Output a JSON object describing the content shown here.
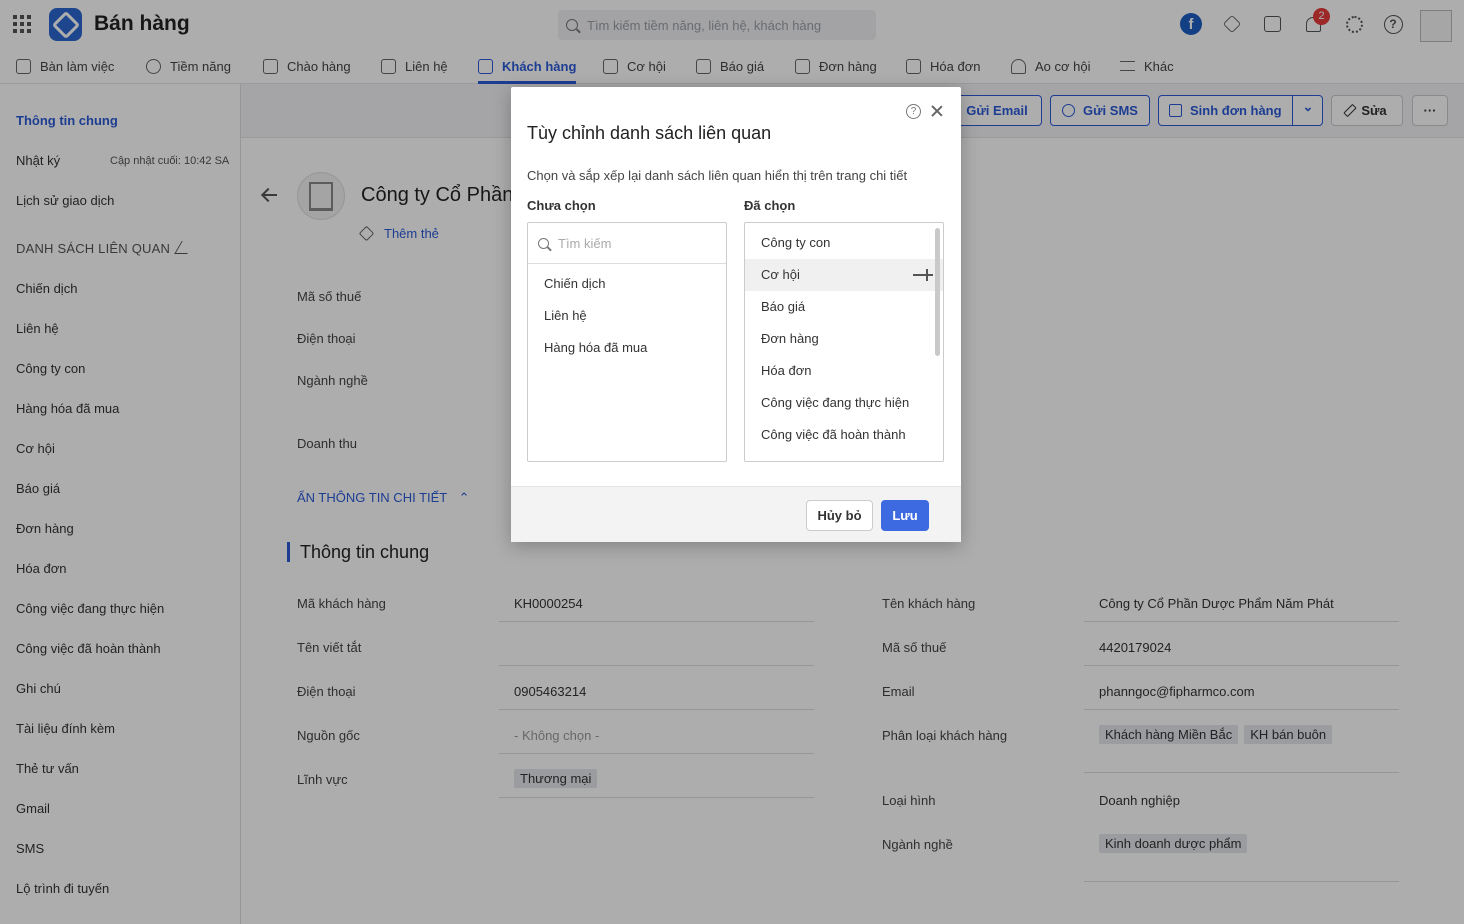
{
  "header": {
    "app_title": "Bán hàng",
    "search_placeholder": "Tìm kiếm tiềm năng, liên hệ, khách hàng",
    "notification_count": "2",
    "facebook_letter": "f"
  },
  "nav": [
    {
      "label": "Bàn làm việc"
    },
    {
      "label": "Tiềm năng"
    },
    {
      "label": "Chào hàng"
    },
    {
      "label": "Liên hệ"
    },
    {
      "label": "Khách hàng"
    },
    {
      "label": "Cơ hội"
    },
    {
      "label": "Báo giá"
    },
    {
      "label": "Đơn hàng"
    },
    {
      "label": "Hóa đơn"
    },
    {
      "label": "Ao cơ hội"
    },
    {
      "label": "Khác"
    }
  ],
  "sidebar": {
    "general_info": "Thông tin chung",
    "diary": "Nhật ký",
    "diary_updated": "Cập nhật cuối: 10:42 SA",
    "history": "Lịch sử giao dịch",
    "related_header": "DANH SÁCH LIÊN QUAN",
    "items": [
      {
        "label": "Chiến dịch"
      },
      {
        "label": "Liên hệ"
      },
      {
        "label": "Công ty con"
      },
      {
        "label": "Hàng hóa đã mua"
      },
      {
        "label": "Cơ hội"
      },
      {
        "label": "Báo giá"
      },
      {
        "label": "Đơn hàng"
      },
      {
        "label": "Hóa đơn"
      },
      {
        "label": "Công việc đang thực hiện"
      },
      {
        "label": "Công việc đã hoàn thành"
      },
      {
        "label": "Ghi chú"
      },
      {
        "label": "Tài liệu đính kèm"
      },
      {
        "label": "Thẻ tư vấn"
      },
      {
        "label": "Gmail"
      },
      {
        "label": "SMS"
      },
      {
        "label": "Lộ trình đi tuyến"
      }
    ],
    "collapse_glyph": "‹"
  },
  "actions": {
    "send_email": "Gửi Email",
    "send_sms": "Gửi SMS",
    "create_order": "Sinh đơn hàng",
    "edit": "Sửa",
    "more": "···",
    "dropdown_glyph": "⌄"
  },
  "record": {
    "company_name": "Công ty Cổ Phần",
    "add_tag": "Thêm thẻ",
    "summary_labels": [
      "Mã số thuế",
      "Điện thoại",
      "Ngành nghề",
      "Doanh thu"
    ],
    "toggle_details": "ẨN THÔNG TIN CHI TIẾT",
    "toggle_glyph": "⌃",
    "section_title": "Thông tin chung",
    "left_fields": [
      {
        "label": "Mã khách hàng",
        "value": "KH0000254"
      },
      {
        "label": "Tên viết tắt",
        "value": ""
      },
      {
        "label": "Điện thoại",
        "value": "0905463214"
      },
      {
        "label": "Nguồn gốc",
        "value": "- Không chọn -"
      },
      {
        "label": "Lĩnh vực",
        "chip": "Thương mại"
      }
    ],
    "right_fields": [
      {
        "label": "Tên khách hàng",
        "value": "Công ty Cổ Phần Dược Phẩm Năm Phát"
      },
      {
        "label": "Mã số thuế",
        "value": "4420179024"
      },
      {
        "label": "Email",
        "value": "phanngoc@fipharmco.com"
      },
      {
        "label": "Phân loại khách hàng",
        "chips": [
          "Khách hàng Miền Bắc",
          "KH bán buôn"
        ]
      },
      {
        "label": "Loại hình",
        "value": "Doanh nghiệp"
      },
      {
        "label": "Ngành nghề",
        "chip": "Kinh doanh dược phẩm"
      }
    ]
  },
  "modal": {
    "title": "Tùy chỉnh danh sách liên quan",
    "help_glyph": "?",
    "description": "Chọn và sắp xếp lại danh sách liên quan hiển thị trên trang chi tiết",
    "unselected_title": "Chưa chọn",
    "selected_title": "Đã chọn",
    "search_placeholder": "Tìm kiếm",
    "unselected": [
      "Chiến dịch",
      "Liên hệ",
      "Hàng hóa đã mua"
    ],
    "selected": [
      "Công ty con",
      "Cơ hội",
      "Báo giá",
      "Đơn hàng",
      "Hóa đơn",
      "Công việc đang thực hiện",
      "Công việc đã hoàn thành"
    ],
    "cancel": "Hủy bỏ",
    "save": "Lưu"
  },
  "colors": {
    "accent": "#2b5bd7",
    "primary_button": "#3e6ae1",
    "badge": "#e63b3b"
  }
}
